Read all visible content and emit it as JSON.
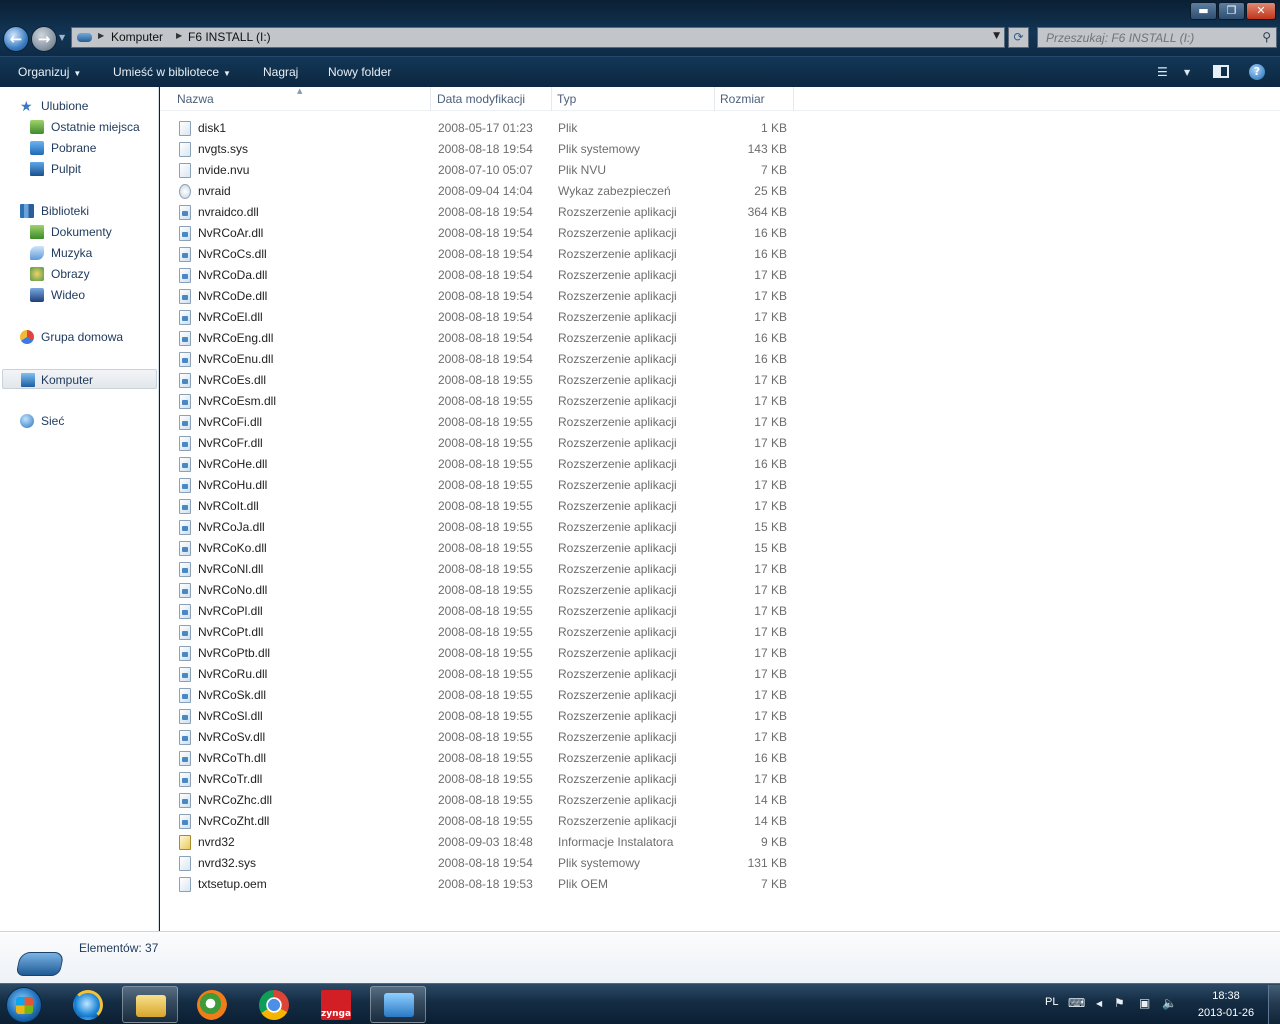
{
  "window": {
    "minimize_glyph": "▬",
    "maximize_glyph": "❐",
    "close_glyph": "✕"
  },
  "address": {
    "crumbs": [
      "Komputer",
      "F6 INSTALL (I:)"
    ]
  },
  "search": {
    "placeholder": "Przeszukaj: F6 INSTALL (I:)"
  },
  "commands": {
    "organize": "Organizuj",
    "add_to_library": "Umieść w bibliotece",
    "burn": "Nagraj",
    "new_folder": "Nowy folder"
  },
  "navigation": {
    "favorites": {
      "label": "Ulubione",
      "items": [
        "Ostatnie miejsca",
        "Pobrane",
        "Pulpit"
      ]
    },
    "libraries": {
      "label": "Biblioteki",
      "items": [
        "Dokumenty",
        "Muzyka",
        "Obrazy",
        "Wideo"
      ]
    },
    "homegroup": "Grupa domowa",
    "computer": "Komputer",
    "network": "Sieć"
  },
  "columns": {
    "name": "Nazwa",
    "date": "Data modyfikacji",
    "type": "Typ",
    "size": "Rozmiar"
  },
  "files": [
    {
      "name": "disk1",
      "date": "2008-05-17 01:23",
      "type": "Plik",
      "size": "1 KB",
      "icon": "file"
    },
    {
      "name": "nvgts.sys",
      "date": "2008-08-18 19:54",
      "type": "Plik systemowy",
      "size": "143 KB",
      "icon": "file"
    },
    {
      "name": "nvide.nvu",
      "date": "2008-07-10 05:07",
      "type": "Plik NVU",
      "size": "7 KB",
      "icon": "file"
    },
    {
      "name": "nvraid",
      "date": "2008-09-04 14:04",
      "type": "Wykaz zabezpieczeń",
      "size": "25 KB",
      "icon": "cat"
    },
    {
      "name": "nvraidco.dll",
      "date": "2008-08-18 19:54",
      "type": "Rozszerzenie aplikacji",
      "size": "364 KB",
      "icon": "dll"
    },
    {
      "name": "NvRCoAr.dll",
      "date": "2008-08-18 19:54",
      "type": "Rozszerzenie aplikacji",
      "size": "16 KB",
      "icon": "dll"
    },
    {
      "name": "NvRCoCs.dll",
      "date": "2008-08-18 19:54",
      "type": "Rozszerzenie aplikacji",
      "size": "16 KB",
      "icon": "dll"
    },
    {
      "name": "NvRCoDa.dll",
      "date": "2008-08-18 19:54",
      "type": "Rozszerzenie aplikacji",
      "size": "17 KB",
      "icon": "dll"
    },
    {
      "name": "NvRCoDe.dll",
      "date": "2008-08-18 19:54",
      "type": "Rozszerzenie aplikacji",
      "size": "17 KB",
      "icon": "dll"
    },
    {
      "name": "NvRCoEl.dll",
      "date": "2008-08-18 19:54",
      "type": "Rozszerzenie aplikacji",
      "size": "17 KB",
      "icon": "dll"
    },
    {
      "name": "NvRCoEng.dll",
      "date": "2008-08-18 19:54",
      "type": "Rozszerzenie aplikacji",
      "size": "16 KB",
      "icon": "dll"
    },
    {
      "name": "NvRCoEnu.dll",
      "date": "2008-08-18 19:54",
      "type": "Rozszerzenie aplikacji",
      "size": "16 KB",
      "icon": "dll"
    },
    {
      "name": "NvRCoEs.dll",
      "date": "2008-08-18 19:55",
      "type": "Rozszerzenie aplikacji",
      "size": "17 KB",
      "icon": "dll"
    },
    {
      "name": "NvRCoEsm.dll",
      "date": "2008-08-18 19:55",
      "type": "Rozszerzenie aplikacji",
      "size": "17 KB",
      "icon": "dll"
    },
    {
      "name": "NvRCoFi.dll",
      "date": "2008-08-18 19:55",
      "type": "Rozszerzenie aplikacji",
      "size": "17 KB",
      "icon": "dll"
    },
    {
      "name": "NvRCoFr.dll",
      "date": "2008-08-18 19:55",
      "type": "Rozszerzenie aplikacji",
      "size": "17 KB",
      "icon": "dll"
    },
    {
      "name": "NvRCoHe.dll",
      "date": "2008-08-18 19:55",
      "type": "Rozszerzenie aplikacji",
      "size": "16 KB",
      "icon": "dll"
    },
    {
      "name": "NvRCoHu.dll",
      "date": "2008-08-18 19:55",
      "type": "Rozszerzenie aplikacji",
      "size": "17 KB",
      "icon": "dll"
    },
    {
      "name": "NvRCoIt.dll",
      "date": "2008-08-18 19:55",
      "type": "Rozszerzenie aplikacji",
      "size": "17 KB",
      "icon": "dll"
    },
    {
      "name": "NvRCoJa.dll",
      "date": "2008-08-18 19:55",
      "type": "Rozszerzenie aplikacji",
      "size": "15 KB",
      "icon": "dll"
    },
    {
      "name": "NvRCoKo.dll",
      "date": "2008-08-18 19:55",
      "type": "Rozszerzenie aplikacji",
      "size": "15 KB",
      "icon": "dll"
    },
    {
      "name": "NvRCoNl.dll",
      "date": "2008-08-18 19:55",
      "type": "Rozszerzenie aplikacji",
      "size": "17 KB",
      "icon": "dll"
    },
    {
      "name": "NvRCoNo.dll",
      "date": "2008-08-18 19:55",
      "type": "Rozszerzenie aplikacji",
      "size": "17 KB",
      "icon": "dll"
    },
    {
      "name": "NvRCoPl.dll",
      "date": "2008-08-18 19:55",
      "type": "Rozszerzenie aplikacji",
      "size": "17 KB",
      "icon": "dll"
    },
    {
      "name": "NvRCoPt.dll",
      "date": "2008-08-18 19:55",
      "type": "Rozszerzenie aplikacji",
      "size": "17 KB",
      "icon": "dll"
    },
    {
      "name": "NvRCoPtb.dll",
      "date": "2008-08-18 19:55",
      "type": "Rozszerzenie aplikacji",
      "size": "17 KB",
      "icon": "dll"
    },
    {
      "name": "NvRCoRu.dll",
      "date": "2008-08-18 19:55",
      "type": "Rozszerzenie aplikacji",
      "size": "17 KB",
      "icon": "dll"
    },
    {
      "name": "NvRCoSk.dll",
      "date": "2008-08-18 19:55",
      "type": "Rozszerzenie aplikacji",
      "size": "17 KB",
      "icon": "dll"
    },
    {
      "name": "NvRCoSl.dll",
      "date": "2008-08-18 19:55",
      "type": "Rozszerzenie aplikacji",
      "size": "17 KB",
      "icon": "dll"
    },
    {
      "name": "NvRCoSv.dll",
      "date": "2008-08-18 19:55",
      "type": "Rozszerzenie aplikacji",
      "size": "17 KB",
      "icon": "dll"
    },
    {
      "name": "NvRCoTh.dll",
      "date": "2008-08-18 19:55",
      "type": "Rozszerzenie aplikacji",
      "size": "16 KB",
      "icon": "dll"
    },
    {
      "name": "NvRCoTr.dll",
      "date": "2008-08-18 19:55",
      "type": "Rozszerzenie aplikacji",
      "size": "17 KB",
      "icon": "dll"
    },
    {
      "name": "NvRCoZhc.dll",
      "date": "2008-08-18 19:55",
      "type": "Rozszerzenie aplikacji",
      "size": "14 KB",
      "icon": "dll"
    },
    {
      "name": "NvRCoZht.dll",
      "date": "2008-08-18 19:55",
      "type": "Rozszerzenie aplikacji",
      "size": "14 KB",
      "icon": "dll"
    },
    {
      "name": "nvrd32",
      "date": "2008-09-03 18:48",
      "type": "Informacje Instalatora",
      "size": "9 KB",
      "icon": "inf"
    },
    {
      "name": "nvrd32.sys",
      "date": "2008-08-18 19:54",
      "type": "Plik systemowy",
      "size": "131 KB",
      "icon": "file"
    },
    {
      "name": "txtsetup.oem",
      "date": "2008-08-18 19:53",
      "type": "Plik OEM",
      "size": "7 KB",
      "icon": "file"
    }
  ],
  "details": {
    "count": "Elementów: 37"
  },
  "taskbar": {
    "pinned": [
      "internet-explorer-icon",
      "windows-explorer-icon",
      "media-player-icon",
      "chrome-icon",
      "zynga-icon",
      "control-panel-icon"
    ],
    "zynga_label": "zynga",
    "language": "PL",
    "time": "18:38",
    "date": "2013-01-26"
  },
  "colors": {
    "accent": "#123656",
    "selection": "#e3e7ec",
    "text_muted": "#6d6d6d"
  }
}
